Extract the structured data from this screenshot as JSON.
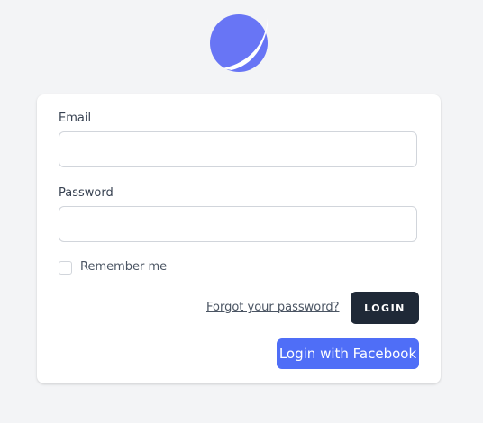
{
  "brand": {
    "logo_icon": "crescent-logo-icon",
    "logo_color": "#6875f5"
  },
  "form": {
    "email_label": "Email",
    "email_value": "",
    "email_placeholder": "",
    "password_label": "Password",
    "password_value": "",
    "password_placeholder": "",
    "remember_label": "Remember me",
    "remember_checked": false,
    "forgot_link": "Forgot your password?",
    "login_button": "LOGIN",
    "facebook_button": "Login with Facebook"
  },
  "colors": {
    "background": "#f3f4f6",
    "card": "#ffffff",
    "login_button": "#1f2937",
    "facebook_button": "#4f6ef7"
  }
}
